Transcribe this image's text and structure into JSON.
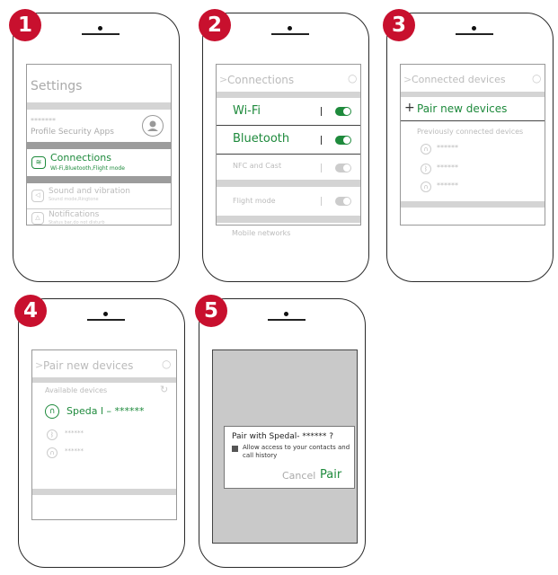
{
  "steps": [
    "1",
    "2",
    "3",
    "4",
    "5"
  ],
  "s1": {
    "title": "Settings",
    "user": "*******",
    "profile_links": "Profile  Security  Apps",
    "connections": "Connections",
    "connections_sub": "Wi-Fi,Bluetooth,Flight mode",
    "sound": "Sound and vibration",
    "sound_sub": "Sound mode,Ringtone",
    "notifications": "Notifications",
    "notifications_sub": "Status bar,do not disturb"
  },
  "s2": {
    "title": "Connections",
    "wifi": "Wi-Fi",
    "bluetooth": "Bluetooth",
    "nfc": "NFC and Cast",
    "flight": "Flight mode",
    "mobile": "Mobile networks"
  },
  "s3": {
    "title": "Connected devices",
    "pair_new": "Pair new devices",
    "prev": "Previously connected devices",
    "devices": [
      "******",
      "******",
      "******"
    ]
  },
  "s4": {
    "title": "Pair new devices",
    "available": "Available devices",
    "device": "Speda l – ******",
    "others": [
      "******",
      "******"
    ]
  },
  "s5": {
    "dialog_title": "Pair with Spedal- ****** ?",
    "checkbox_text": "Allow access to your contacts and call history",
    "cancel": "Cancel",
    "pair": "Pair"
  },
  "colors": {
    "badge": "#c8102e",
    "accent": "#1e8a3c"
  }
}
